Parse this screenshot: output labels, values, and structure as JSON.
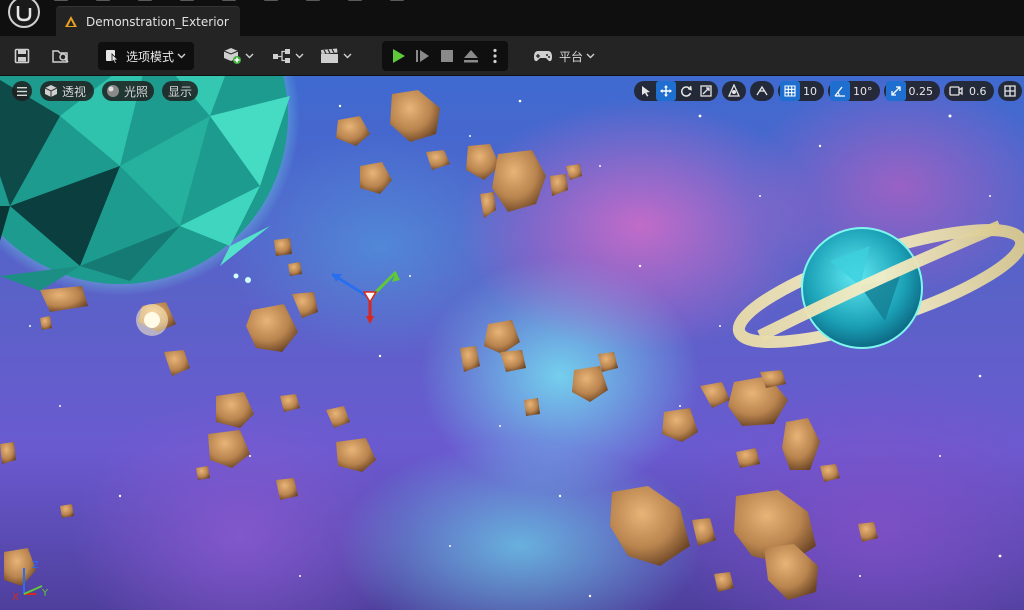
{
  "window": {
    "document_tab": "Demonstration_Exterior"
  },
  "toolbar": {
    "select_mode_label": "选项模式",
    "platform_label": "平台"
  },
  "viewport": {
    "perspective_label": "透视",
    "lit_label": "光照",
    "show_label": "显示",
    "grid_snap_value": "10",
    "rotation_snap_value": "10°",
    "scale_snap_value": "0.25",
    "camera_speed_value": "0.6",
    "axis_z": "Z",
    "axis_x": "X",
    "axis_y": "Y"
  },
  "colors": {
    "accent": "#1e6fd0",
    "play_green": "#5fc93a",
    "tab_icon": "#e8a020"
  },
  "icons": {
    "logo": "unreal-logo-icon",
    "save": "save-icon",
    "content_browser": "folder-search-icon",
    "select_mode": "cursor-icon",
    "add_actor": "add-cube-icon",
    "blueprints": "blueprint-icon",
    "cinematics": "clapper-icon",
    "play": "play-icon",
    "frame_advance": "step-icon",
    "stop": "stop-icon",
    "eject": "eject-icon",
    "more": "more-vertical-icon",
    "platform": "gamepad-icon"
  }
}
